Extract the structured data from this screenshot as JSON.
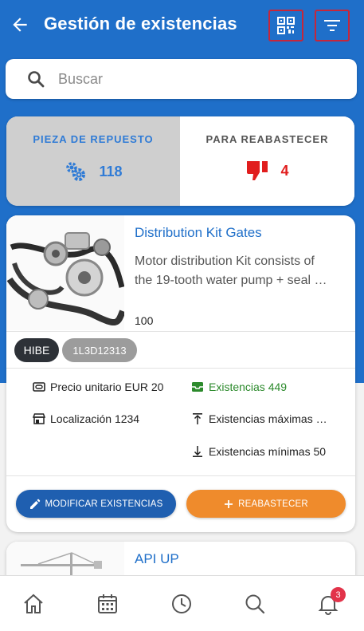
{
  "header": {
    "title": "Gestión de existencias",
    "back_icon": "arrow-left-icon",
    "qr_icon": "qr-code-icon",
    "filter_icon": "filter-icon"
  },
  "search": {
    "placeholder": "Buscar",
    "value": ""
  },
  "summary": {
    "spare_parts": {
      "label": "PIEZA DE REPUESTO",
      "count": "118",
      "icon": "gears-icon"
    },
    "restock": {
      "label": "PARA REABASTECER",
      "count": "4",
      "icon": "thumbs-down-icon"
    }
  },
  "product": {
    "name": "Distribution Kit Gates",
    "description_line1": "Motor distribution Kit consists of",
    "description_line2": "the 19-tooth water pump + seal …",
    "quantity": "100",
    "brand": "HIBE",
    "reference": "1L3D12313",
    "unit_price": "Precio unitario EUR 20",
    "stock": "Existencias 449",
    "location": "Localización 1234",
    "max_stock": "Existencias máximas …",
    "min_stock": "Existencias mínimas 50",
    "modify_button": "MODIFICAR EXISTENCIAS",
    "restock_button": "REABASTECER"
  },
  "product2": {
    "name": "API UP"
  },
  "nav": {
    "items": [
      "home-icon",
      "calendar-icon",
      "clock-icon",
      "search-icon",
      "bell-icon"
    ],
    "notification_count": "3"
  },
  "colors": {
    "primary": "#1f6fc9",
    "accent": "#ef8b2c",
    "alert": "#e11d1d",
    "success": "#2c8a2c"
  }
}
